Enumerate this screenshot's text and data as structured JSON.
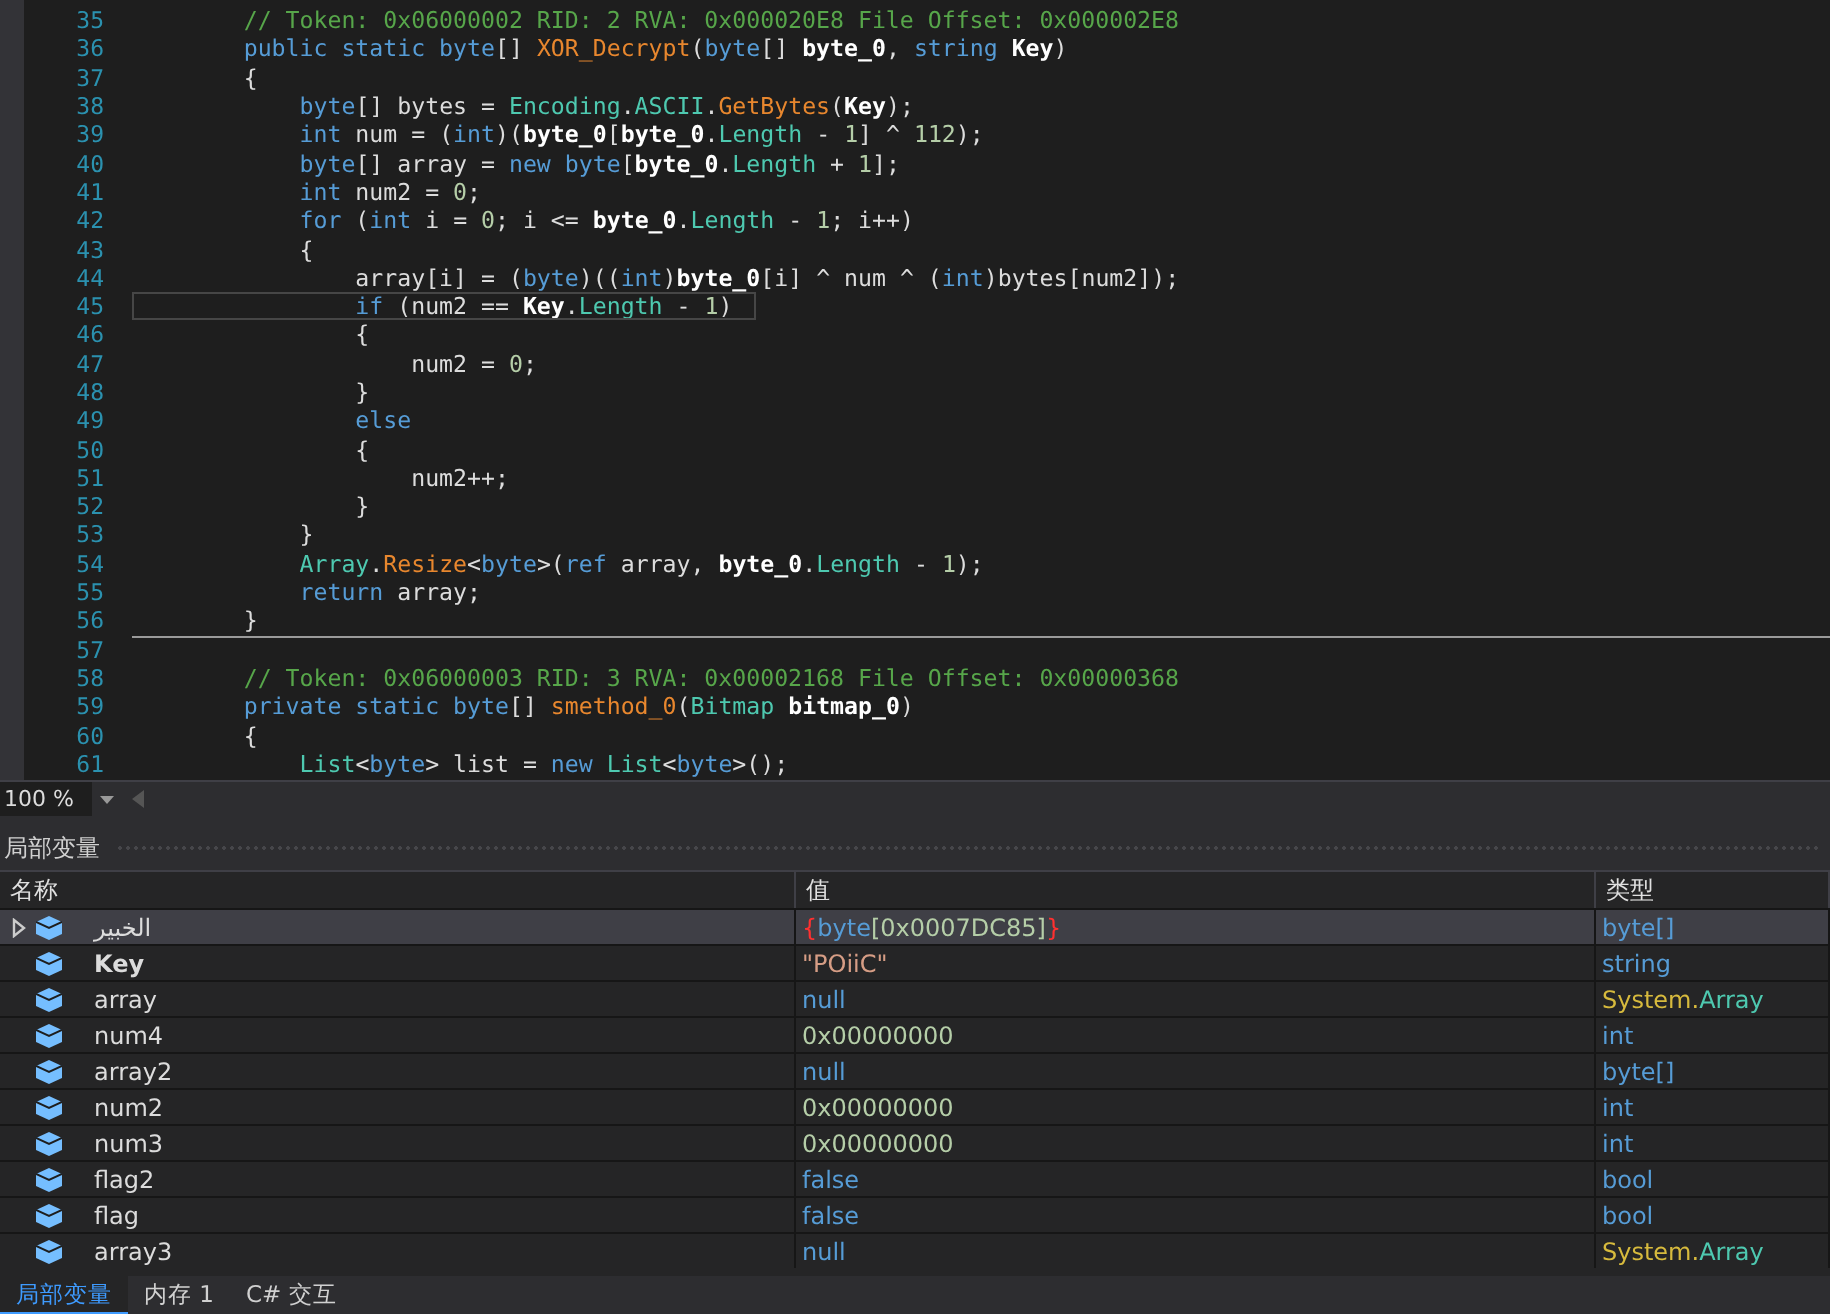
{
  "editor": {
    "lines": [
      {
        "number": "35",
        "current": false,
        "separator": false,
        "tokens": [
          {
            "kind": "comment",
            "text": "        // Token: 0x06000002 RID: 2 RVA: 0x000020E8 File Offset: 0x000002E8"
          }
        ]
      },
      {
        "number": "36",
        "current": false,
        "separator": false,
        "tokens": [
          {
            "kind": "keyword",
            "text": "        public static byte"
          },
          {
            "kind": "plain",
            "text": "[] "
          },
          {
            "kind": "method",
            "text": "XOR_Decrypt"
          },
          {
            "kind": "plain",
            "text": "("
          },
          {
            "kind": "keyword",
            "text": "byte"
          },
          {
            "kind": "plain",
            "text": "[] "
          },
          {
            "kind": "bold",
            "text": "byte_0"
          },
          {
            "kind": "plain",
            "text": ", "
          },
          {
            "kind": "keyword",
            "text": "string "
          },
          {
            "kind": "bold",
            "text": "Key"
          },
          {
            "kind": "plain",
            "text": ")"
          }
        ]
      },
      {
        "number": "37",
        "current": false,
        "separator": false,
        "tokens": [
          {
            "kind": "plain",
            "text": "        {"
          }
        ]
      },
      {
        "number": "38",
        "current": false,
        "separator": false,
        "tokens": [
          {
            "kind": "keyword",
            "text": "            byte"
          },
          {
            "kind": "plain",
            "text": "[] bytes = "
          },
          {
            "kind": "type",
            "text": "Encoding"
          },
          {
            "kind": "plain",
            "text": "."
          },
          {
            "kind": "type",
            "text": "ASCII"
          },
          {
            "kind": "plain",
            "text": "."
          },
          {
            "kind": "method",
            "text": "GetBytes"
          },
          {
            "kind": "plain",
            "text": "("
          },
          {
            "kind": "bold",
            "text": "Key"
          },
          {
            "kind": "plain",
            "text": ");"
          }
        ]
      },
      {
        "number": "39",
        "current": false,
        "separator": false,
        "tokens": [
          {
            "kind": "keyword",
            "text": "            int"
          },
          {
            "kind": "plain",
            "text": " num = ("
          },
          {
            "kind": "keyword",
            "text": "int"
          },
          {
            "kind": "plain",
            "text": ")("
          },
          {
            "kind": "bold",
            "text": "byte_0"
          },
          {
            "kind": "plain",
            "text": "["
          },
          {
            "kind": "bold",
            "text": "byte_0"
          },
          {
            "kind": "plain",
            "text": "."
          },
          {
            "kind": "type",
            "text": "Length"
          },
          {
            "kind": "plain",
            "text": " - "
          },
          {
            "kind": "number",
            "text": "1"
          },
          {
            "kind": "plain",
            "text": "] ^ "
          },
          {
            "kind": "number",
            "text": "112"
          },
          {
            "kind": "plain",
            "text": ");"
          }
        ]
      },
      {
        "number": "40",
        "current": false,
        "separator": false,
        "tokens": [
          {
            "kind": "keyword",
            "text": "            byte"
          },
          {
            "kind": "plain",
            "text": "[] array = "
          },
          {
            "kind": "keyword",
            "text": "new byte"
          },
          {
            "kind": "plain",
            "text": "["
          },
          {
            "kind": "bold",
            "text": "byte_0"
          },
          {
            "kind": "plain",
            "text": "."
          },
          {
            "kind": "type",
            "text": "Length"
          },
          {
            "kind": "plain",
            "text": " + "
          },
          {
            "kind": "number",
            "text": "1"
          },
          {
            "kind": "plain",
            "text": "];"
          }
        ]
      },
      {
        "number": "41",
        "current": false,
        "separator": false,
        "tokens": [
          {
            "kind": "keyword",
            "text": "            int"
          },
          {
            "kind": "plain",
            "text": " num2 = "
          },
          {
            "kind": "number",
            "text": "0"
          },
          {
            "kind": "plain",
            "text": ";"
          }
        ]
      },
      {
        "number": "42",
        "current": false,
        "separator": false,
        "tokens": [
          {
            "kind": "keyword",
            "text": "            for"
          },
          {
            "kind": "plain",
            "text": " ("
          },
          {
            "kind": "keyword",
            "text": "int"
          },
          {
            "kind": "plain",
            "text": " i = "
          },
          {
            "kind": "number",
            "text": "0"
          },
          {
            "kind": "plain",
            "text": "; i <= "
          },
          {
            "kind": "bold",
            "text": "byte_0"
          },
          {
            "kind": "plain",
            "text": "."
          },
          {
            "kind": "type",
            "text": "Length"
          },
          {
            "kind": "plain",
            "text": " - "
          },
          {
            "kind": "number",
            "text": "1"
          },
          {
            "kind": "plain",
            "text": "; i++)"
          }
        ]
      },
      {
        "number": "43",
        "current": false,
        "separator": false,
        "tokens": [
          {
            "kind": "plain",
            "text": "            {"
          }
        ]
      },
      {
        "number": "44",
        "current": false,
        "separator": false,
        "tokens": [
          {
            "kind": "plain",
            "text": "                array[i] = ("
          },
          {
            "kind": "keyword",
            "text": "byte"
          },
          {
            "kind": "plain",
            "text": ")(("
          },
          {
            "kind": "keyword",
            "text": "int"
          },
          {
            "kind": "plain",
            "text": ")"
          },
          {
            "kind": "bold",
            "text": "byte_0"
          },
          {
            "kind": "plain",
            "text": "[i] ^ num ^ ("
          },
          {
            "kind": "keyword",
            "text": "int"
          },
          {
            "kind": "plain",
            "text": ")bytes[num2]);"
          }
        ]
      },
      {
        "number": "45",
        "current": true,
        "separator": false,
        "tokens": [
          {
            "kind": "keyword",
            "text": "                if"
          },
          {
            "kind": "plain",
            "text": " (num2 == "
          },
          {
            "kind": "bold",
            "text": "Key"
          },
          {
            "kind": "plain",
            "text": "."
          },
          {
            "kind": "type",
            "text": "Length"
          },
          {
            "kind": "plain",
            "text": " - "
          },
          {
            "kind": "number",
            "text": "1"
          },
          {
            "kind": "plain",
            "text": ")"
          }
        ]
      },
      {
        "number": "46",
        "current": false,
        "separator": false,
        "tokens": [
          {
            "kind": "plain",
            "text": "                {"
          }
        ]
      },
      {
        "number": "47",
        "current": false,
        "separator": false,
        "tokens": [
          {
            "kind": "plain",
            "text": "                    num2 = "
          },
          {
            "kind": "number",
            "text": "0"
          },
          {
            "kind": "plain",
            "text": ";"
          }
        ]
      },
      {
        "number": "48",
        "current": false,
        "separator": false,
        "tokens": [
          {
            "kind": "plain",
            "text": "                }"
          }
        ]
      },
      {
        "number": "49",
        "current": false,
        "separator": false,
        "tokens": [
          {
            "kind": "keyword",
            "text": "                else"
          }
        ]
      },
      {
        "number": "50",
        "current": false,
        "separator": false,
        "tokens": [
          {
            "kind": "plain",
            "text": "                {"
          }
        ]
      },
      {
        "number": "51",
        "current": false,
        "separator": false,
        "tokens": [
          {
            "kind": "plain",
            "text": "                    num2++;"
          }
        ]
      },
      {
        "number": "52",
        "current": false,
        "separator": false,
        "tokens": [
          {
            "kind": "plain",
            "text": "                }"
          }
        ]
      },
      {
        "number": "53",
        "current": false,
        "separator": false,
        "tokens": [
          {
            "kind": "plain",
            "text": "            }"
          }
        ]
      },
      {
        "number": "54",
        "current": false,
        "separator": false,
        "tokens": [
          {
            "kind": "type",
            "text": "            Array"
          },
          {
            "kind": "plain",
            "text": "."
          },
          {
            "kind": "method",
            "text": "Resize"
          },
          {
            "kind": "plain",
            "text": "<"
          },
          {
            "kind": "keyword",
            "text": "byte"
          },
          {
            "kind": "plain",
            "text": ">("
          },
          {
            "kind": "keyword",
            "text": "ref"
          },
          {
            "kind": "plain",
            "text": " array, "
          },
          {
            "kind": "bold",
            "text": "byte_0"
          },
          {
            "kind": "plain",
            "text": "."
          },
          {
            "kind": "type",
            "text": "Length"
          },
          {
            "kind": "plain",
            "text": " - "
          },
          {
            "kind": "number",
            "text": "1"
          },
          {
            "kind": "plain",
            "text": ");"
          }
        ]
      },
      {
        "number": "55",
        "current": false,
        "separator": false,
        "tokens": [
          {
            "kind": "keyword",
            "text": "            return"
          },
          {
            "kind": "plain",
            "text": " array;"
          }
        ]
      },
      {
        "number": "56",
        "current": false,
        "separator": false,
        "tokens": [
          {
            "kind": "plain",
            "text": "        }"
          }
        ]
      },
      {
        "number": "57",
        "current": false,
        "separator": true
      },
      {
        "number": "58",
        "current": false,
        "separator": false,
        "tokens": [
          {
            "kind": "comment",
            "text": "        // Token: 0x06000003 RID: 3 RVA: 0x00002168 File Offset: 0x00000368"
          }
        ]
      },
      {
        "number": "59",
        "current": false,
        "separator": false,
        "tokens": [
          {
            "kind": "keyword",
            "text": "        private static byte"
          },
          {
            "kind": "plain",
            "text": "[] "
          },
          {
            "kind": "method",
            "text": "smethod_0"
          },
          {
            "kind": "plain",
            "text": "("
          },
          {
            "kind": "type",
            "text": "Bitmap "
          },
          {
            "kind": "bold",
            "text": "bitmap_0"
          },
          {
            "kind": "plain",
            "text": ")"
          }
        ]
      },
      {
        "number": "60",
        "current": false,
        "separator": false,
        "tokens": [
          {
            "kind": "plain",
            "text": "        {"
          }
        ]
      },
      {
        "number": "61",
        "current": false,
        "separator": false,
        "tokens": [
          {
            "kind": "type",
            "text": "            List"
          },
          {
            "kind": "plain",
            "text": "<"
          },
          {
            "kind": "keyword",
            "text": "byte"
          },
          {
            "kind": "plain",
            "text": "> list = "
          },
          {
            "kind": "keyword",
            "text": "new "
          },
          {
            "kind": "type",
            "text": "List"
          },
          {
            "kind": "plain",
            "text": "<"
          },
          {
            "kind": "keyword",
            "text": "byte"
          },
          {
            "kind": "plain",
            "text": ">();"
          }
        ]
      }
    ]
  },
  "zoom": {
    "value": "100 %"
  },
  "locals": {
    "title": "局部变量",
    "columns": [
      "名称",
      "值",
      "类型"
    ],
    "rows": [
      {
        "name": "الخبير",
        "bold": false,
        "expandable": true,
        "selected": true,
        "value": [
          {
            "kind": "brace",
            "text": "{"
          },
          {
            "kind": "keyword",
            "text": "byte"
          },
          {
            "kind": "number",
            "text": "[0x0007DC85]"
          },
          {
            "kind": "brace",
            "text": "}"
          }
        ],
        "type": [
          {
            "kind": "keyword",
            "text": "byte[]"
          }
        ]
      },
      {
        "name": "Key",
        "bold": true,
        "expandable": false,
        "selected": false,
        "value": [
          {
            "kind": "string",
            "text": "\"POiiC\""
          }
        ],
        "type": [
          {
            "kind": "keyword",
            "text": "string"
          }
        ]
      },
      {
        "name": "array",
        "bold": false,
        "expandable": false,
        "selected": false,
        "value": [
          {
            "kind": "keyword",
            "text": "null"
          }
        ],
        "type": [
          {
            "kind": "namespace",
            "text": "System."
          },
          {
            "kind": "type",
            "text": "Array"
          }
        ]
      },
      {
        "name": "num4",
        "bold": false,
        "expandable": false,
        "selected": false,
        "value": [
          {
            "kind": "number",
            "text": "0x00000000"
          }
        ],
        "type": [
          {
            "kind": "keyword",
            "text": "int"
          }
        ]
      },
      {
        "name": "array2",
        "bold": false,
        "expandable": false,
        "selected": false,
        "value": [
          {
            "kind": "keyword",
            "text": "null"
          }
        ],
        "type": [
          {
            "kind": "keyword",
            "text": "byte[]"
          }
        ]
      },
      {
        "name": "num2",
        "bold": false,
        "expandable": false,
        "selected": false,
        "value": [
          {
            "kind": "number",
            "text": "0x00000000"
          }
        ],
        "type": [
          {
            "kind": "keyword",
            "text": "int"
          }
        ]
      },
      {
        "name": "num3",
        "bold": false,
        "expandable": false,
        "selected": false,
        "value": [
          {
            "kind": "number",
            "text": "0x00000000"
          }
        ],
        "type": [
          {
            "kind": "keyword",
            "text": "int"
          }
        ]
      },
      {
        "name": "flag2",
        "bold": false,
        "expandable": false,
        "selected": false,
        "value": [
          {
            "kind": "keyword",
            "text": "false"
          }
        ],
        "type": [
          {
            "kind": "keyword",
            "text": "bool"
          }
        ]
      },
      {
        "name": "flag",
        "bold": false,
        "expandable": false,
        "selected": false,
        "value": [
          {
            "kind": "keyword",
            "text": "false"
          }
        ],
        "type": [
          {
            "kind": "keyword",
            "text": "bool"
          }
        ]
      },
      {
        "name": "array3",
        "bold": false,
        "expandable": false,
        "selected": false,
        "value": [
          {
            "kind": "keyword",
            "text": "null"
          }
        ],
        "type": [
          {
            "kind": "namespace",
            "text": "System."
          },
          {
            "kind": "type",
            "text": "Array"
          }
        ]
      }
    ]
  },
  "bottom_tabs": [
    {
      "label": "局部变量",
      "selected": true
    },
    {
      "label": "内存 1",
      "selected": false
    },
    {
      "label": "C# 交互",
      "selected": false
    }
  ]
}
